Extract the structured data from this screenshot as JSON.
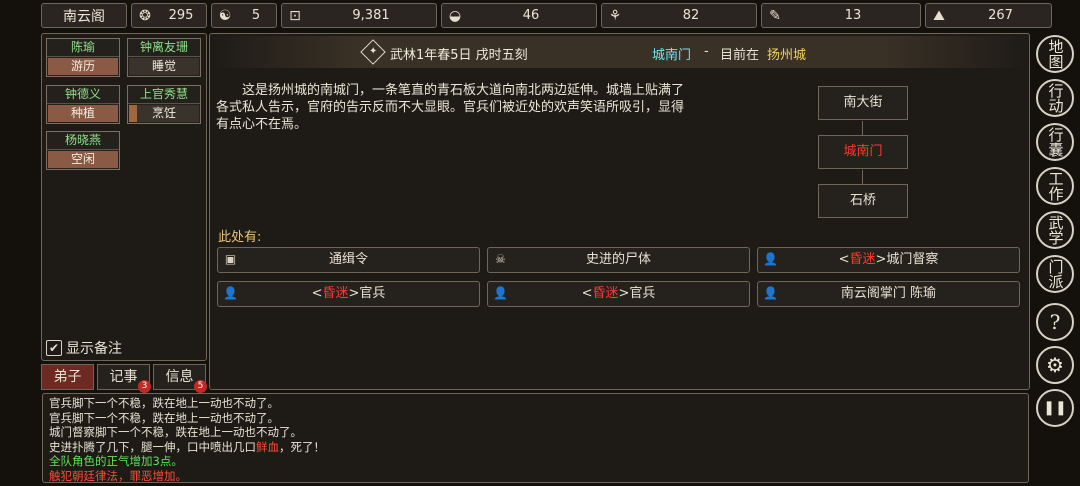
{
  "top_bar": {
    "sect_name": "南云阁",
    "stats": [
      {
        "icon": "coin-bag-icon",
        "value": "295"
      },
      {
        "icon": "yin-yang-icon",
        "value": "5"
      },
      {
        "icon": "copper-coin-icon",
        "value": "9,381"
      },
      {
        "icon": "food-bowl-icon",
        "value": "46"
      },
      {
        "icon": "herb-icon",
        "value": "82"
      },
      {
        "icon": "scroll-icon",
        "value": "13"
      },
      {
        "icon": "ore-icon",
        "value": "267"
      }
    ]
  },
  "roster": [
    {
      "name": "陈瑜",
      "status": "游历"
    },
    {
      "name": "钟离友珊",
      "status": "睡觉"
    },
    {
      "name": "钟德义",
      "status": "种植"
    },
    {
      "name": "上官秀慧",
      "status": "烹饪"
    },
    {
      "name": "杨晓燕",
      "status": "空闲"
    }
  ],
  "show_notes_label": "显示备注",
  "tabs": [
    {
      "label": "弟子",
      "badge": ""
    },
    {
      "label": "记事",
      "badge": "3"
    },
    {
      "label": "信息",
      "badge": "5"
    }
  ],
  "header": {
    "date": "武林1年春5日 戌时五刻",
    "location": "城南门",
    "separator": "-",
    "current_prefix": "目前在",
    "city": "扬州城"
  },
  "description": "这是扬州城的南城门，一条笔直的青石板大道向南北两边延伸。城墙上贴满了各式私人告示，官府的告示反而不大显眼。官兵们被近处的欢声笑语所吸引，显得有点心不在焉。",
  "map": {
    "north": "南大街",
    "current": "城南门",
    "south": "石桥"
  },
  "here_label": "此处有:",
  "entities": [
    {
      "icon": "box-icon",
      "prefix": "",
      "state": "",
      "suffix": "",
      "name": "通缉令"
    },
    {
      "icon": "skull-icon",
      "prefix": "",
      "state": "",
      "suffix": "",
      "name": "史进的尸体"
    },
    {
      "icon": "person-icon",
      "prefix": "<",
      "state": "昏迷",
      "suffix": ">",
      "name": "城门督察"
    },
    {
      "icon": "person-icon",
      "prefix": "<",
      "state": "昏迷",
      "suffix": ">",
      "name": "官兵"
    },
    {
      "icon": "person-icon",
      "prefix": "<",
      "state": "昏迷",
      "suffix": ">",
      "name": "官兵"
    },
    {
      "icon": "person-icon",
      "prefix": "",
      "state": "",
      "suffix": "",
      "name": "南云阁掌门 陈瑜"
    }
  ],
  "side_menu": [
    {
      "label": "地图"
    },
    {
      "label": "行动"
    },
    {
      "label": "行囊"
    },
    {
      "label": "工作"
    },
    {
      "label": "武学"
    },
    {
      "label": "门派"
    },
    {
      "label": "?"
    },
    {
      "label": "⚙"
    },
    {
      "label": "❚❚"
    }
  ],
  "log": [
    {
      "text": "官兵脚下一个不稳，跌在地上一动也不动了。"
    },
    {
      "text": "官兵脚下一个不稳，跌在地上一动也不动了。"
    },
    {
      "text": "城门督察脚下一个不稳，跌在地上一动也不动了。"
    },
    {
      "pre": "史进扑腾了几下，腿一伸，口中喷出几口",
      "hl": "鲜血",
      "post": "，死了！"
    },
    {
      "text": "全队角色的正气增加3点。",
      "color": "green"
    },
    {
      "text": "触犯朝廷律法，罪恶增加。",
      "color": "red"
    }
  ],
  "colors": {
    "accent_red": "#ff3a2e",
    "name_green": "#8fe08a",
    "log_green": "#5fe05a",
    "tab_active": "#6d2a22"
  }
}
